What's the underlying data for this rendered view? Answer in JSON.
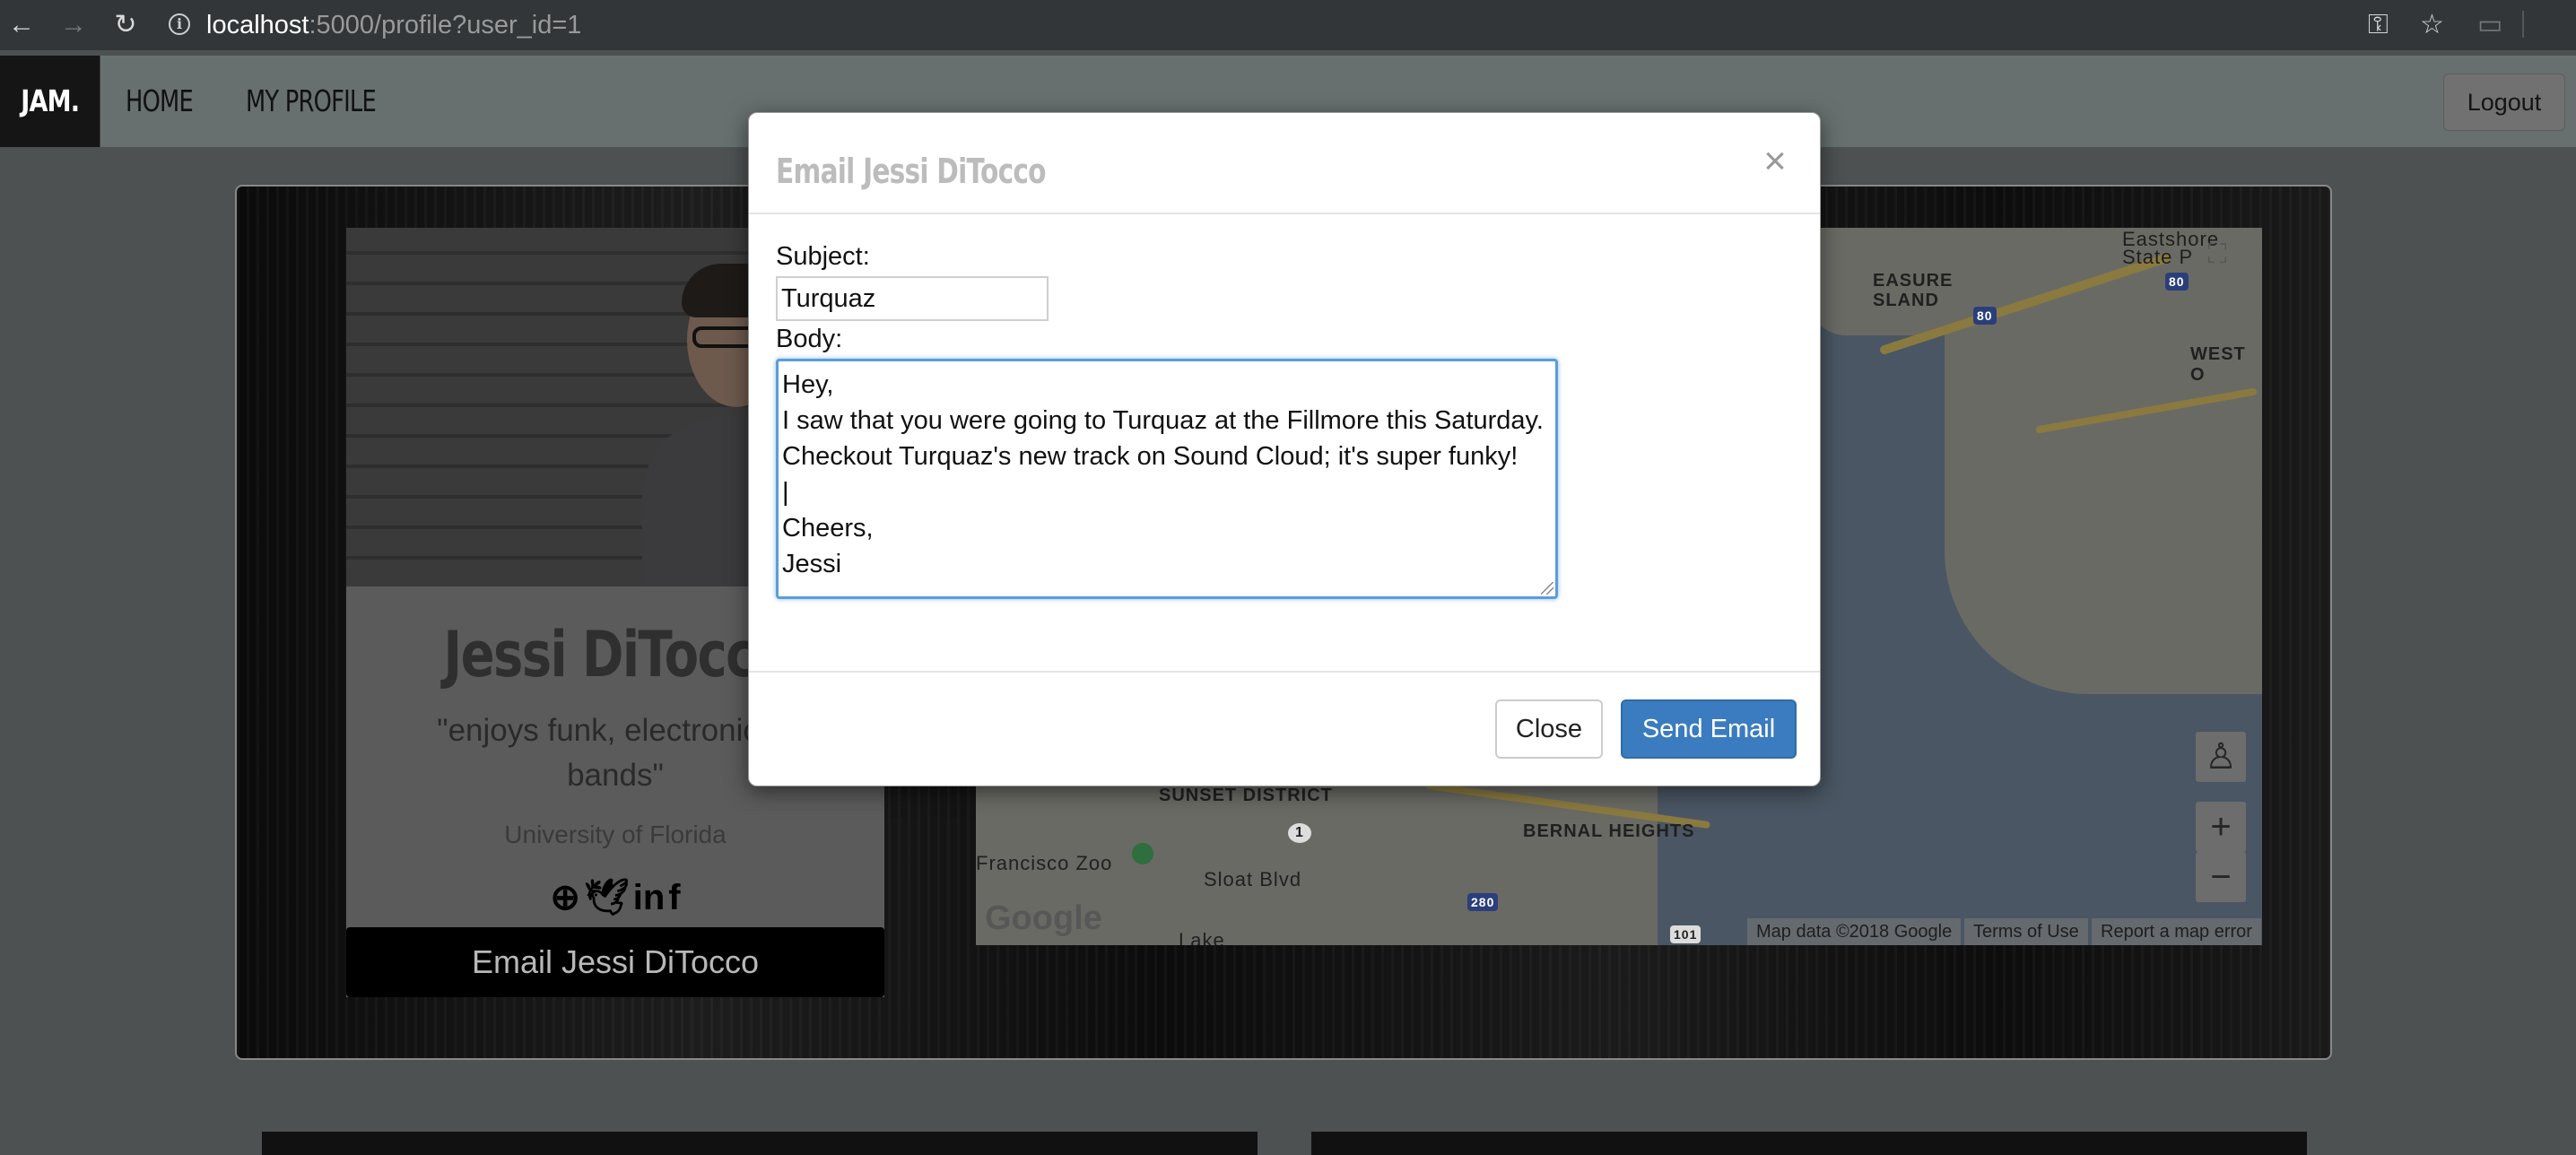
{
  "browser": {
    "url_host": "localhost",
    "url_rest": ":5000/profile?user_id=1",
    "icons": [
      "back-arrow-icon",
      "forward-arrow-icon",
      "reload-icon",
      "info-icon",
      "key-icon",
      "star-icon",
      "cast-icon"
    ]
  },
  "header": {
    "brand": "JAM.",
    "nav": [
      "HOME",
      "MY PROFILE"
    ],
    "logout_label": "Logout"
  },
  "profile": {
    "name": "Jessi DiTocco",
    "quote_line1": "\"enjoys funk, electronic, a",
    "quote_line2": "bands\"",
    "school": "University of Florida",
    "social_icons": [
      "dribbble-icon",
      "twitter-icon",
      "linkedin-icon",
      "facebook-icon"
    ],
    "email_button": "Email Jessi DiTocco"
  },
  "map": {
    "labels": [
      "EASURE",
      "SLAND",
      "Eastshore",
      "State P",
      "WEST O",
      "SUNSET DISTRICT",
      "BERNAL HEIGHTS",
      "Francisco Zoo",
      "Sloat Blvd",
      "Lake",
      "80",
      "80",
      "1",
      "280",
      "101"
    ],
    "google_logo": "Google",
    "footer": [
      "Map data ©2018 Google",
      "Terms of Use",
      "Report a map error"
    ],
    "zoom_in": "+",
    "zoom_out": "−"
  },
  "modal": {
    "title": "Email Jessi DiTocco",
    "close_symbol": "×",
    "subject_label": "Subject:",
    "subject_value": "Turquaz",
    "body_label": "Body:",
    "body_lines": [
      "Hey,",
      "I saw that you were going to Turquaz at the Fillmore this Saturday.",
      "Checkout Turquaz's new track on Sound Cloud; it's super funky!",
      "|",
      "Cheers,",
      "Jessi"
    ],
    "close_button": "Close",
    "send_button": "Send Email"
  }
}
